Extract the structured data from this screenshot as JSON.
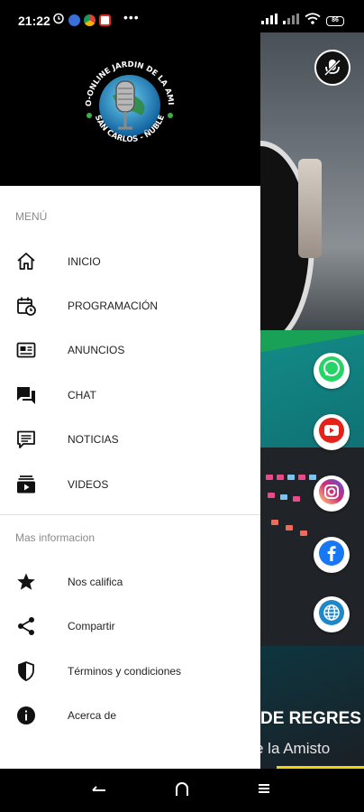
{
  "status_bar": {
    "time": "21:22",
    "dots": "•••",
    "battery": "86",
    "icons": [
      "alarm-icon",
      "messenger-icon",
      "chrome-icon",
      "gmail-icon",
      "signal-icon",
      "wifi-icon",
      "battery-icon"
    ]
  },
  "drawer": {
    "logo_text_top": "RADIO-ONLINE JARDIN DE LA AMISTAD",
    "logo_text_bottom": "SAN CARLOS - ÑUBLE",
    "menu_section": "MENÚ",
    "menu_items": [
      {
        "label": "INICIO",
        "icon": "home-icon"
      },
      {
        "label": "PROGRAMACIÓN",
        "icon": "calendar-clock-icon"
      },
      {
        "label": "ANUNCIOS",
        "icon": "newspaper-icon"
      },
      {
        "label": "CHAT",
        "icon": "chat-icon"
      },
      {
        "label": "NOTICIAS",
        "icon": "comment-text-icon"
      },
      {
        "label": "VIDEOS",
        "icon": "video-library-icon"
      }
    ],
    "more_section": "Mas informacion",
    "more_items": [
      {
        "label": "Nos califica",
        "icon": "star-icon"
      },
      {
        "label": "Compartir",
        "icon": "share-icon"
      },
      {
        "label": "Términos y condiciones",
        "icon": "shield-icon"
      },
      {
        "label": "Acerca de",
        "icon": "info-icon"
      }
    ]
  },
  "background_app": {
    "title": "DE REGRES",
    "subtitle": "e la Amisto",
    "social_buttons": [
      "whatsapp-icon",
      "youtube-icon",
      "instagram-icon",
      "facebook-icon",
      "web-icon"
    ],
    "colors": {
      "whatsapp": "#25d366",
      "youtube": "#e62117",
      "instagram": "#d6249f",
      "facebook": "#1877f2",
      "web": "#1e88c8",
      "accent": "#f1d20b"
    }
  }
}
